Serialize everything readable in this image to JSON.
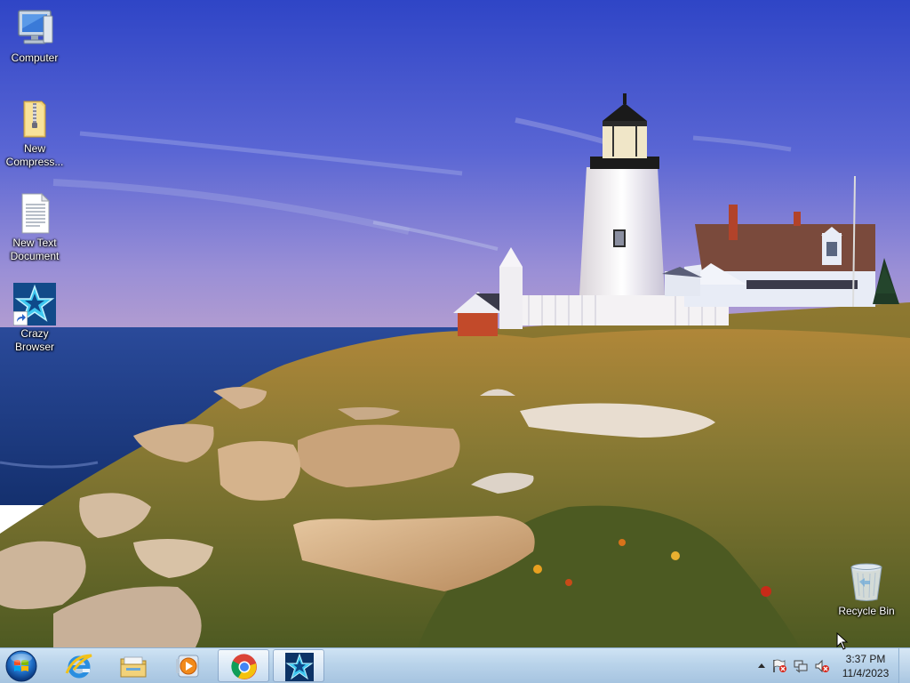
{
  "desktop": {
    "icons": [
      {
        "label": "Computer",
        "icon": "computer-icon"
      },
      {
        "label": "New Compress...",
        "icon": "zip-folder-icon"
      },
      {
        "label": "New Text Document",
        "icon": "text-document-icon"
      },
      {
        "label": "Crazy Browser",
        "icon": "crazy-browser-icon",
        "shortcut": true
      },
      {
        "label": "Recycle Bin",
        "icon": "recycle-bin-icon"
      }
    ],
    "wallpaper": "lighthouse-coast"
  },
  "taskbar": {
    "start_icon": "windows-start-orb-icon",
    "pinned": [
      {
        "icon": "internet-explorer-icon",
        "active": false
      },
      {
        "icon": "file-explorer-icon",
        "active": false
      },
      {
        "icon": "media-player-icon",
        "active": false
      },
      {
        "icon": "chrome-icon",
        "active": true
      },
      {
        "icon": "crazy-browser-icon",
        "active": true
      }
    ],
    "tray": {
      "icons": [
        "show-hidden-icons-chevron-icon",
        "action-center-flag-icon",
        "network-icon",
        "volume-muted-icon"
      ]
    },
    "clock": {
      "time": "3:37 PM",
      "date": "11/4/2023"
    }
  },
  "colors": {
    "taskbar": "#b9d3ea",
    "sky_top": "#3048c8",
    "sky_bottom": "#8a8ad8",
    "sea": "#1f3f8a"
  }
}
